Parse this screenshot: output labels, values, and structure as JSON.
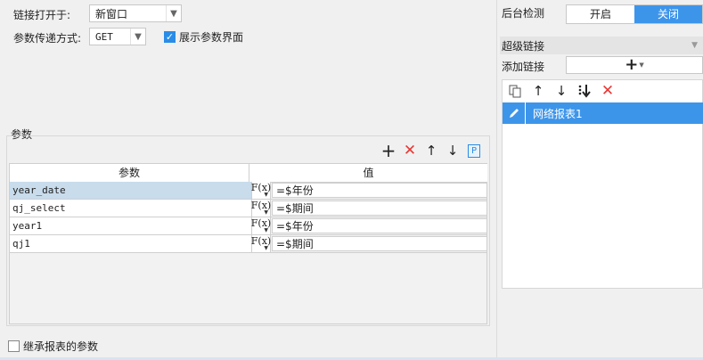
{
  "link_open": {
    "label": "链接打开于:",
    "value": "新窗口"
  },
  "param_method": {
    "label": "参数传递方式:",
    "value": "GET"
  },
  "show_param_ui": {
    "label": "展示参数界面",
    "checked": true
  },
  "params": {
    "group_title": "参数",
    "toolbar": [
      "add-icon",
      "delete-icon",
      "move-up-icon",
      "move-down-icon",
      "param-p-icon"
    ],
    "toolbar_p": "P",
    "headers": {
      "param": "参数",
      "value": "值"
    },
    "fx_label": "F(x)",
    "rows": [
      {
        "name": "year_date",
        "value": "=$年份",
        "selected": true
      },
      {
        "name": "qj_select",
        "value": "=$期间",
        "selected": false
      },
      {
        "name": "year1",
        "value": "=$年份",
        "selected": false
      },
      {
        "name": "qj1",
        "value": "=$期间",
        "selected": false
      }
    ]
  },
  "inherit": {
    "label": "继承报表的参数",
    "checked": false
  },
  "backend_check": {
    "label": "后台检测",
    "on": "开启",
    "off": "关闭",
    "active": "off"
  },
  "hyperlink": {
    "section_title": "超级链接",
    "add_label": "添加链接",
    "add_symbol": "+",
    "items": [
      {
        "label": "网络报表1"
      }
    ]
  },
  "colors": {
    "accent": "#3d95ea",
    "selected_row": "#c8dcec",
    "danger": "#e53935"
  }
}
